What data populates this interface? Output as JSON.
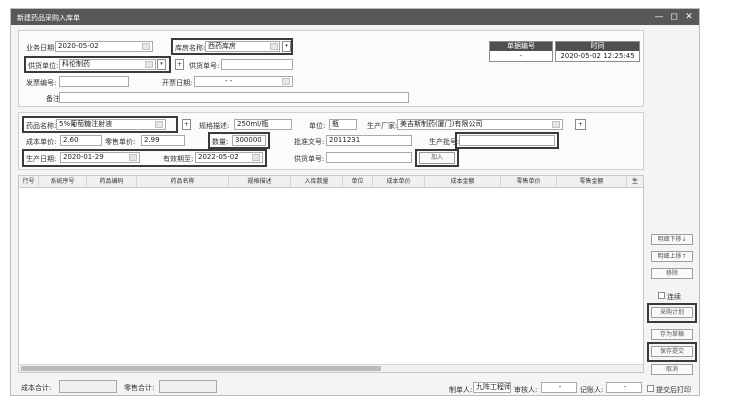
{
  "window": {
    "title": "新建药品采购入库单",
    "controls": [
      "—",
      "◻",
      "✕"
    ]
  },
  "header": {
    "biz_date_label": "业务日期:",
    "biz_date_value": "2020-05-02",
    "warehouse_label": "库房名称:",
    "warehouse_value": "西药库房",
    "supplier_label": "供货单位:",
    "supplier_value": "科伦制药",
    "supply_no_label": "供货单号:",
    "supply_no_value": "",
    "invoice_label": "发票编号:",
    "invoice_value": "",
    "invoice_date_label": "开票日期:",
    "invoice_date_value": "- -",
    "remark_label": "备注:",
    "remark_value": "",
    "doc_no_label": "单据编号",
    "doc_no_value": "-",
    "time_label": "时间",
    "time_value": "2020-05-02 12:25:45"
  },
  "drug": {
    "name_label": "药品名称:",
    "name_value": "5%葡萄糖注射液",
    "spec_label": "规格描述:",
    "spec_value": "250ml/瓶",
    "unit_label": "单位:",
    "unit_value": "瓶",
    "maker_label": "生产厂家:",
    "maker_value": "美吉斯制药(厦门)有限公司",
    "cost_label": "成本单价:",
    "cost_value": "2.60",
    "retail_label": "零售单价:",
    "retail_value": "2.99",
    "qty_label": "数量:",
    "qty_value": "300000",
    "approval_label": "批准文号:",
    "approval_value": "2011231",
    "batch_label": "生产批号:",
    "batch_value": "",
    "prod_date_label": "生产日期:",
    "prod_date_value": "2020-01-29",
    "expire_label": "有效期至:",
    "expire_value": "2022-05-02",
    "supply_no_label": "供货单号:",
    "supply_no_value": "",
    "add_button": "加入"
  },
  "table": {
    "columns": [
      "行号",
      "系统序号",
      "药品编码",
      "药品名称",
      "规格描述",
      "入库数量",
      "单位",
      "成本单价",
      "成本金额",
      "零售单价",
      "零售金额",
      "生"
    ]
  },
  "side": {
    "move_down": "明细下移↓",
    "move_up": "明细上移↑",
    "remove": "移除",
    "continue_label": "连续",
    "purchase_plan": "采购计划",
    "save_draft": "存为草稿",
    "save_submit": "保存提交",
    "cancel": "取消"
  },
  "footer": {
    "cost_total_label": "成本合计:",
    "cost_total_value": "",
    "retail_total_label": "零售合计:",
    "retail_total_value": "",
    "maker_label": "制单人:",
    "maker_value": "九阵工程师",
    "reviewer_label": "审核人:",
    "reviewer_value": "-",
    "accounting_label": "记账人:",
    "accounting_value": "-",
    "print_label": "提交后打印"
  },
  "colors": {
    "titlebar": "#585858",
    "infohead": "#4f4f4f",
    "highlight": "#3a3a3a"
  }
}
